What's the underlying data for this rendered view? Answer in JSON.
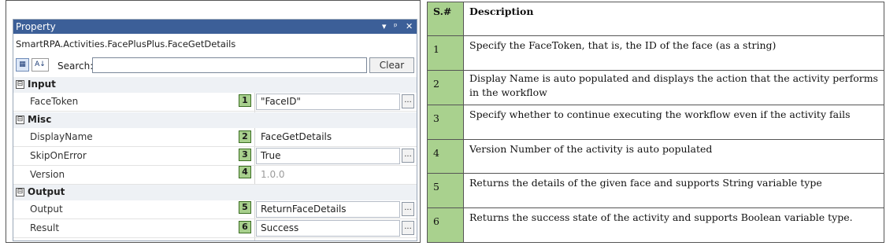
{
  "panel": {
    "title": "Property",
    "title_controls": {
      "dropdown": "▾",
      "pin": "ᵖ",
      "close": "✕"
    },
    "activity_name": "SmartRPA.Activities.FacePlusPlus.FaceGetDetails",
    "toolbar": {
      "categorized": "▦",
      "sort_az": "A↓",
      "search_label": "Search:",
      "search_value": "",
      "clear_label": "Clear"
    },
    "categories": [
      {
        "label": "Input",
        "toggle": "⊟"
      },
      {
        "label": "Misc",
        "toggle": "⊟"
      },
      {
        "label": "Output",
        "toggle": "⊟"
      }
    ],
    "rows": [
      {
        "name": "FaceToken",
        "value": "\"FaceID\"",
        "badge": "1"
      },
      {
        "name": "DisplayName",
        "value": "FaceGetDetails",
        "badge": "2"
      },
      {
        "name": "SkipOnError",
        "value": "True",
        "badge": "3"
      },
      {
        "name": "Version",
        "value": "1.0.0",
        "badge": "4"
      },
      {
        "name": "Output",
        "value": "ReturnFaceDetails",
        "badge": "5"
      },
      {
        "name": "Result",
        "value": "Success",
        "badge": "6"
      }
    ],
    "ellipsis": "..."
  },
  "table": {
    "headers": {
      "num": "S.#",
      "desc": "Description"
    },
    "rows": [
      {
        "num": "1",
        "text": "Specify the FaceToken, that is, the ID of the face (as a string)"
      },
      {
        "num": "2",
        "text": "Display Name is auto populated and displays the action that the activity performs in the workflow"
      },
      {
        "num": "3",
        "text": "Specify whether to continue executing the workflow even if the activity fails"
      },
      {
        "num": "4",
        "text": "Version Number of the activity is auto populated"
      },
      {
        "num": "5",
        "text": "Returns the details of the given face and supports String variable type"
      },
      {
        "num": "6",
        "text": "Returns the success state of the activity and supports Boolean variable type."
      }
    ]
  },
  "colors": {
    "title_bar": "#3c5f98",
    "badge_green": "#a8d08d",
    "table_num_green": "#a9d18e"
  }
}
